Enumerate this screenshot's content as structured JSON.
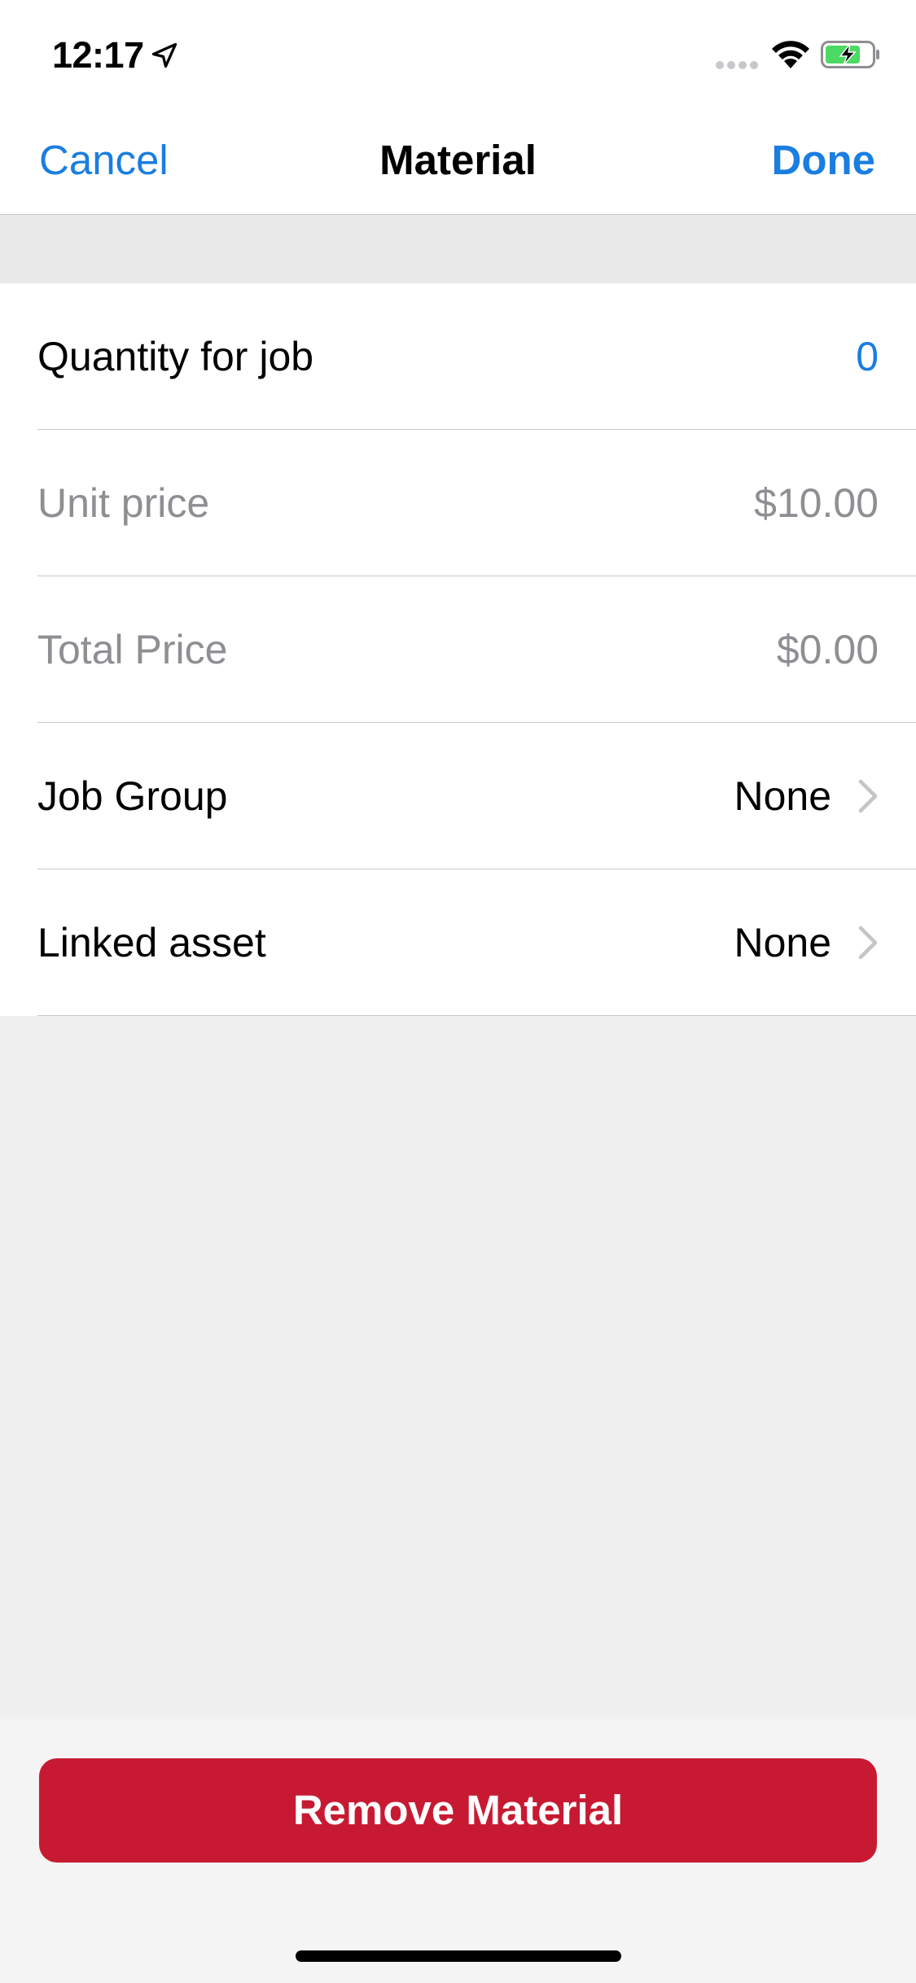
{
  "status_bar": {
    "time": "12:17",
    "location_icon": "location-arrow-icon",
    "signal_icon": "cellular-signal-icon",
    "wifi_icon": "wifi-icon",
    "battery_icon": "battery-charging-icon",
    "battery_color": "#4cd964"
  },
  "nav": {
    "cancel_label": "Cancel",
    "title": "Material",
    "done_label": "Done",
    "accent_color": "#1a7ee0"
  },
  "form": {
    "rows": [
      {
        "label": "Quantity for job",
        "value": "0"
      },
      {
        "label": "Unit price",
        "value": "$10.00"
      },
      {
        "label": "Total Price",
        "value": "$0.00"
      },
      {
        "label": "Job Group",
        "value": "None",
        "icon": "chevron-right-icon"
      },
      {
        "label": "Linked asset",
        "value": "None",
        "icon": "chevron-right-icon"
      }
    ]
  },
  "actions": {
    "remove_label": "Remove Material",
    "remove_color": "#c71a32"
  }
}
